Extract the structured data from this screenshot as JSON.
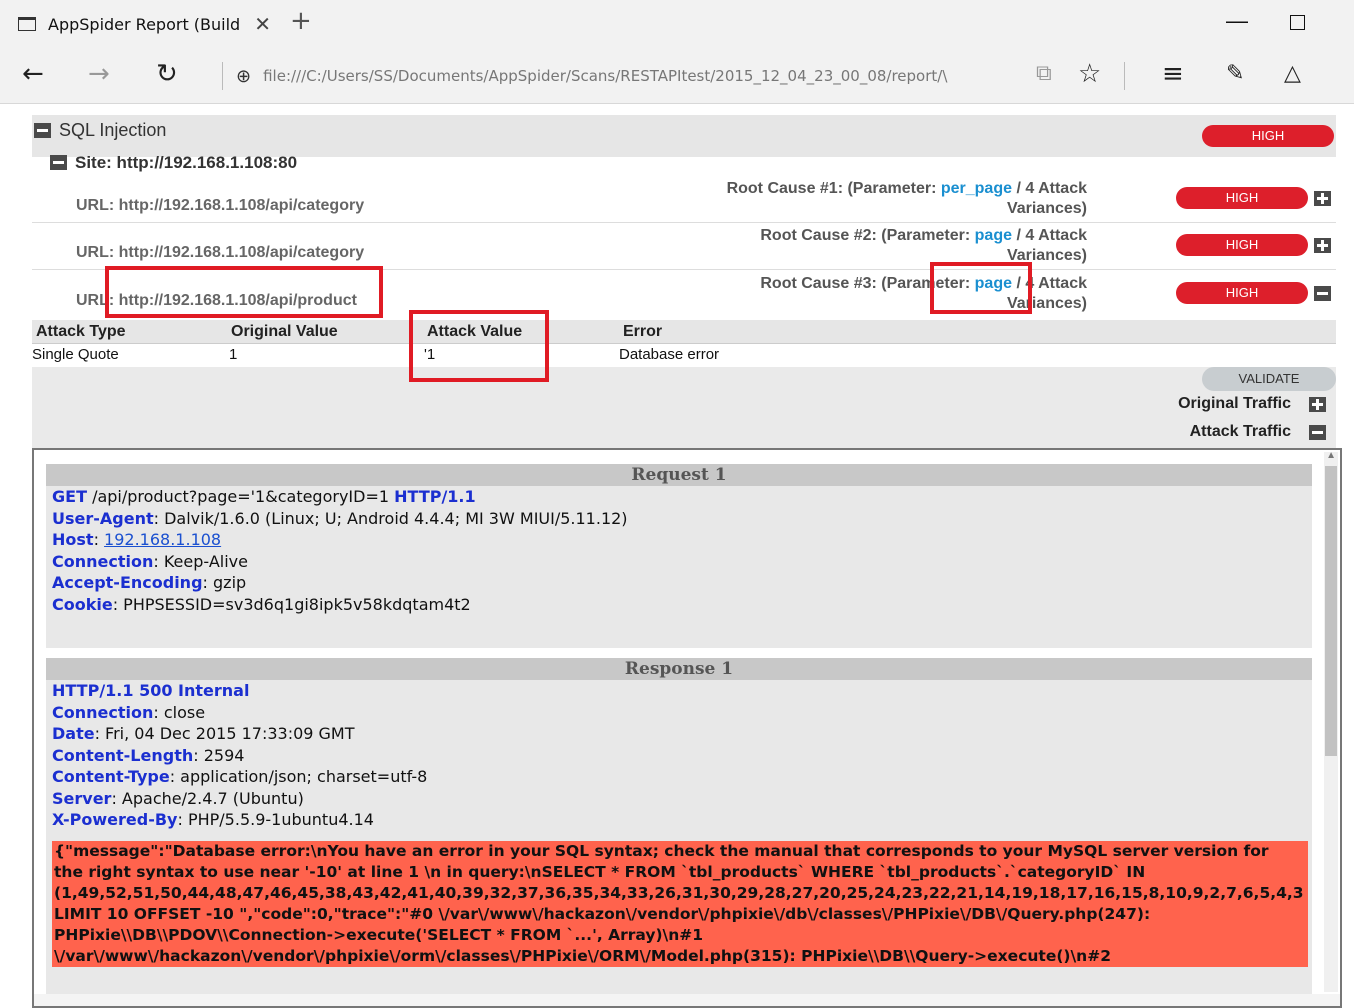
{
  "browser": {
    "tab_title": "AppSpider Report (Build",
    "tab_close": "✕",
    "new_tab": "+",
    "address": "file:///C:/Users/SS/Documents/AppSpider/Scans/RESTAPItest/2015_12_04_23_00_08/report/\\"
  },
  "vuln": {
    "title": "SQL Injection",
    "severity": "HIGH",
    "site_label": "Site: http://192.168.1.108:80",
    "rows": [
      {
        "url": "URL: http://192.168.1.108/api/category",
        "rc_prefix": "Root Cause #1:",
        "rc_mid": " (Parameter: ",
        "param": "per_page",
        "rc_suffix": " / 4 Attack",
        "rc_line2": "Variances)",
        "severity": "HIGH"
      },
      {
        "url": "URL: http://192.168.1.108/api/category",
        "rc_prefix": "Root Cause #2:",
        "rc_mid": " (Parameter: ",
        "param": "page",
        "rc_suffix": " / 4 Attack",
        "rc_line2": "Variances)",
        "severity": "HIGH"
      },
      {
        "url": "URL: http://192.168.1.108/api/product",
        "rc_prefix": "Root Cause #3:",
        "rc_mid": " (Parameter: ",
        "param": "page",
        "rc_suffix": " / 4 Attack",
        "rc_line2": "Variances)",
        "severity": "HIGH"
      }
    ]
  },
  "attack_table": {
    "headers": [
      "Attack Type",
      "Original Value",
      "Attack Value",
      "Error"
    ],
    "row": [
      "Single Quote",
      "1",
      "'1",
      "Database error"
    ]
  },
  "actions": {
    "validate": "VALIDATE",
    "original_traffic": "Original Traffic",
    "attack_traffic": "Attack Traffic"
  },
  "request": {
    "title": "Request 1",
    "method": "GET",
    "path": " /api/product?page='1&categoryID=1 ",
    "proto": "HTTP/1.1",
    "headers": [
      {
        "k": "User-Agent",
        "v": ": Dalvik/1.6.0 (Linux; U; Android 4.4.4; MI 3W MIUI/5.11.12)"
      },
      {
        "k": "Host",
        "v": "192.168.1.108"
      },
      {
        "k": "Connection",
        "v": ": Keep-Alive"
      },
      {
        "k": "Accept-Encoding",
        "v": ": gzip"
      },
      {
        "k": "Cookie",
        "v": ": PHPSESSID=sv3d6q1gi8ipk5v58kdqtam4t2"
      }
    ]
  },
  "response": {
    "title": "Response 1",
    "status": "HTTP/1.1 500 Internal",
    "headers": [
      {
        "k": "Connection",
        "v": ": close"
      },
      {
        "k": "Date",
        "v": ": Fri, 04 Dec 2015 17:33:09 GMT"
      },
      {
        "k": "Content-Length",
        "v": ": 2594"
      },
      {
        "k": "Content-Type",
        "v": ": application/json; charset=utf-8"
      },
      {
        "k": "Server",
        "v": ": Apache/2.4.7 (Ubuntu)"
      },
      {
        "k": "X-Powered-By",
        "v": ": PHP/5.5.9-1ubuntu4.14"
      }
    ],
    "body_lines": [
      "{\"message\":\"Database error:\\nYou have an error in your SQL syntax; check the manual that corresponds to your MySQL server version for",
      "the right syntax to use near '-10' at line 1 \\n in query:\\nSELECT * FROM `tbl_products` WHERE `tbl_products`.`categoryID` IN",
      "(1,49,52,51,50,44,48,47,46,45,38,43,42,41,40,39,32,37,36,35,34,33,26,31,30,29,28,27,20,25,24,23,22,21,14,19,18,17,16,15,8,10,9,2,7,6,5,4,3",
      "LIMIT 10 OFFSET -10 \",\"code\":0,\"trace\":\"#0 \\/var\\/www\\/hackazon\\/vendor\\/phpixie\\/db\\/classes\\/PHPixie\\/DB\\/Query.php(247):",
      "PHPixie\\\\DB\\\\PDOV\\\\Connection->execute('SELECT * FROM `...', Array)\\n#1",
      "\\/var\\/www\\/hackazon\\/vendor\\/phpixie\\/orm\\/classes\\/PHPixie\\/ORM\\/Model.php(315): PHPixie\\\\DB\\\\Query->execute()\\n#2"
    ]
  },
  "colors": {
    "severity_high": "#dd1f2b",
    "param_link": "#1a8fd0",
    "header_key": "#1b2fd0",
    "error_bg": "#ff634d",
    "highlight": "#e01b24"
  }
}
